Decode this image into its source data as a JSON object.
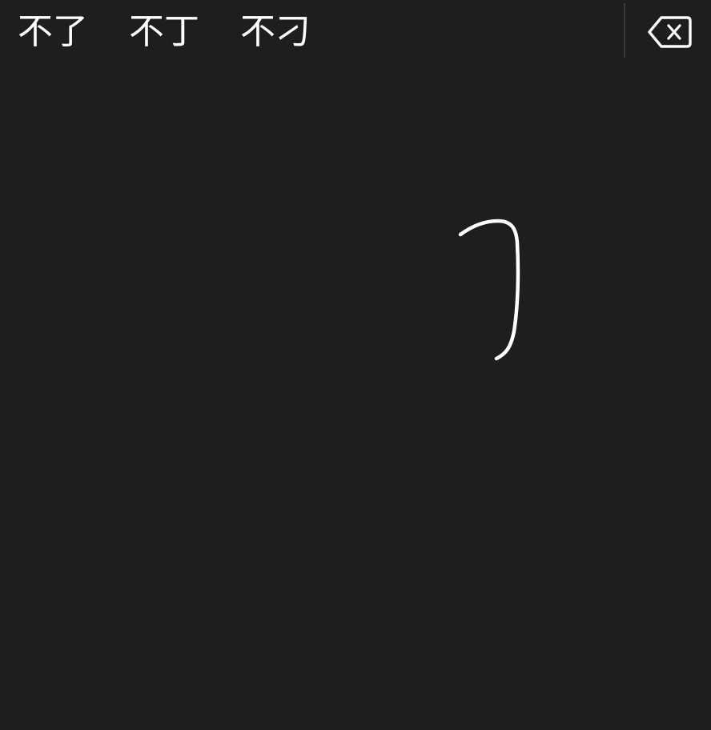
{
  "candidates": [
    {
      "text": "不了"
    },
    {
      "text": "不丁"
    },
    {
      "text": "不刁"
    }
  ],
  "delete_icon": "delete-backspace-icon",
  "colors": {
    "background": "#1e1d20",
    "text": "#ffffff",
    "divider": "#3a393c",
    "stroke": "#ffffff"
  }
}
